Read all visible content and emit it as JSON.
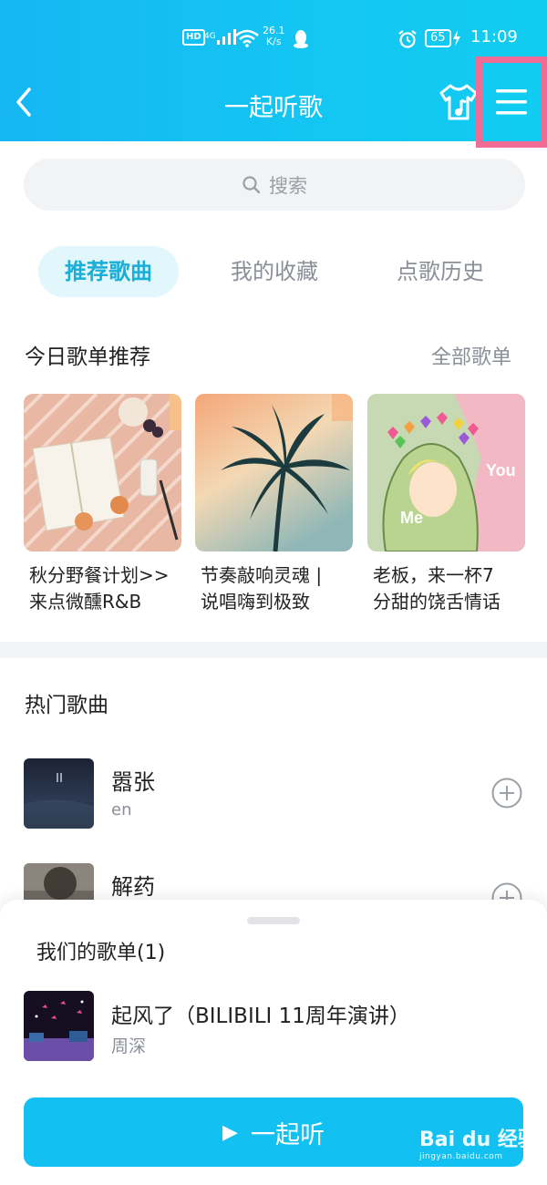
{
  "status_bar": {
    "hd": "HD",
    "network": "4G",
    "speed_value": "26.1",
    "speed_unit": "K/s",
    "battery": "65",
    "time": "11:09"
  },
  "nav": {
    "title": "一起听歌"
  },
  "search": {
    "placeholder": "搜索"
  },
  "tabs": [
    {
      "label": "推荐歌曲",
      "active": true
    },
    {
      "label": "我的收藏",
      "active": false
    },
    {
      "label": "点歌历史",
      "active": false
    }
  ],
  "playlists_section": {
    "title": "今日歌单推荐",
    "more": "全部歌单",
    "items": [
      {
        "line1": "秋分野餐计划>>",
        "line2": "来点微醺R&B"
      },
      {
        "line1": "节奏敲响灵魂 |",
        "line2": "说唱嗨到极致"
      },
      {
        "line1": "老板，来一杯7",
        "line2": "分甜的饶舌情话",
        "cover_text_1": "You",
        "cover_text_2": "Me"
      }
    ]
  },
  "hot_songs": {
    "title": "热门歌曲",
    "items": [
      {
        "name": "嚣张",
        "artist": "en"
      },
      {
        "name": "解药",
        "artist": ""
      }
    ]
  },
  "sheet": {
    "title": "我们的歌单(1)",
    "song_name": "起风了（BILIBILI 11周年演讲）",
    "song_artist": "周深",
    "button_label": "一起听"
  },
  "watermark": {
    "main": "Bai du 经验",
    "sub": "jingyan.baidu.com"
  },
  "colors": {
    "header": "#16b7f3",
    "accent": "#12c1f2",
    "highlight_box": "#f06c94"
  }
}
